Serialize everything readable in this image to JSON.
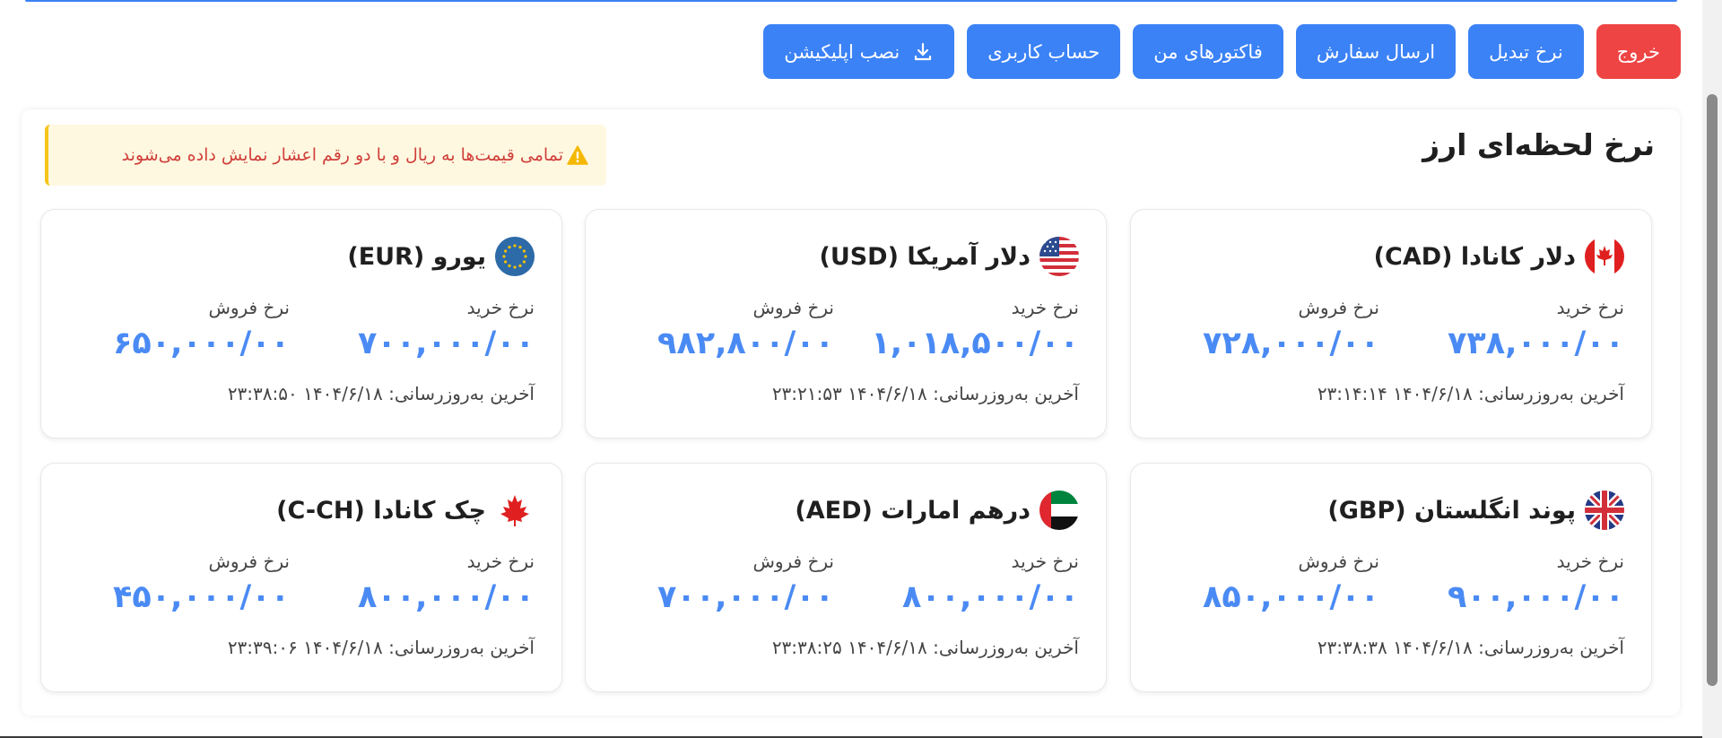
{
  "toolbar": {
    "exit_label": "خروج",
    "rates_label": "نرخ تبدیل",
    "order_label": "ارسال سفارش",
    "invoices_label": "فاکتورهای من",
    "account_label": "حساب کاربری",
    "install_label": "نصب اپلیکیشن",
    "install_icon": "download-icon",
    "colors": {
      "primary": "#3b82f6",
      "danger": "#ef4444"
    }
  },
  "panel": {
    "title": "نرخ لحظه‌ای ارز",
    "notice_icon": "warning-icon",
    "notice_text": "تمامی قیمت‌ها به ریال و با دو رقم اعشار نمایش داده می‌شوند"
  },
  "cards": [
    {
      "flag": "canada-flag-icon",
      "name": "دلار کانادا (CAD)",
      "buy_label": "نرخ خرید",
      "buy": "۷۳۸,۰۰۰/۰۰",
      "sell_label": "نرخ فروش",
      "sell": "۷۲۸,۰۰۰/۰۰",
      "updated": "آخرین به‌روزرسانی: ۱۴۰۴/۶/۱۸ ۲۳:۱۴:۱۴"
    },
    {
      "flag": "usa-flag-icon",
      "name": "دلار آمریکا (USD)",
      "buy_label": "نرخ خرید",
      "buy": "۱,۰۱۸,۵۰۰/۰۰",
      "sell_label": "نرخ فروش",
      "sell": "۹۸۲,۸۰۰/۰۰",
      "updated": "آخرین به‌روزرسانی: ۱۴۰۴/۶/۱۸ ۲۳:۲۱:۵۳"
    },
    {
      "flag": "eu-flag-icon",
      "name": "یورو (EUR)",
      "buy_label": "نرخ خرید",
      "buy": "۷۰۰,۰۰۰/۰۰",
      "sell_label": "نرخ فروش",
      "sell": "۶۵۰,۰۰۰/۰۰",
      "updated": "آخرین به‌روزرسانی: ۱۴۰۴/۶/۱۸ ۲۳:۳۸:۵۰"
    },
    {
      "flag": "uk-flag-icon",
      "name": "پوند انگلستان (GBP)",
      "buy_label": "نرخ خرید",
      "buy": "۹۰۰,۰۰۰/۰۰",
      "sell_label": "نرخ فروش",
      "sell": "۸۵۰,۰۰۰/۰۰",
      "updated": "آخرین به‌روزرسانی: ۱۴۰۴/۶/۱۸ ۲۳:۳۸:۳۸"
    },
    {
      "flag": "uae-flag-icon",
      "name": "درهم امارات (AED)",
      "buy_label": "نرخ خرید",
      "buy": "۸۰۰,۰۰۰/۰۰",
      "sell_label": "نرخ فروش",
      "sell": "۷۰۰,۰۰۰/۰۰",
      "updated": "آخرین به‌روزرسانی: ۱۴۰۴/۶/۱۸ ۲۳:۳۸:۲۵"
    },
    {
      "flag": "maple-leaf-icon",
      "name": "چک کانادا (C-CH)",
      "buy_label": "نرخ خرید",
      "buy": "۸۰۰,۰۰۰/۰۰",
      "sell_label": "نرخ فروش",
      "sell": "۴۵۰,۰۰۰/۰۰",
      "updated": "آخرین به‌روزرسانی: ۱۴۰۴/۶/۱۸ ۲۳:۳۹:۰۶"
    }
  ]
}
